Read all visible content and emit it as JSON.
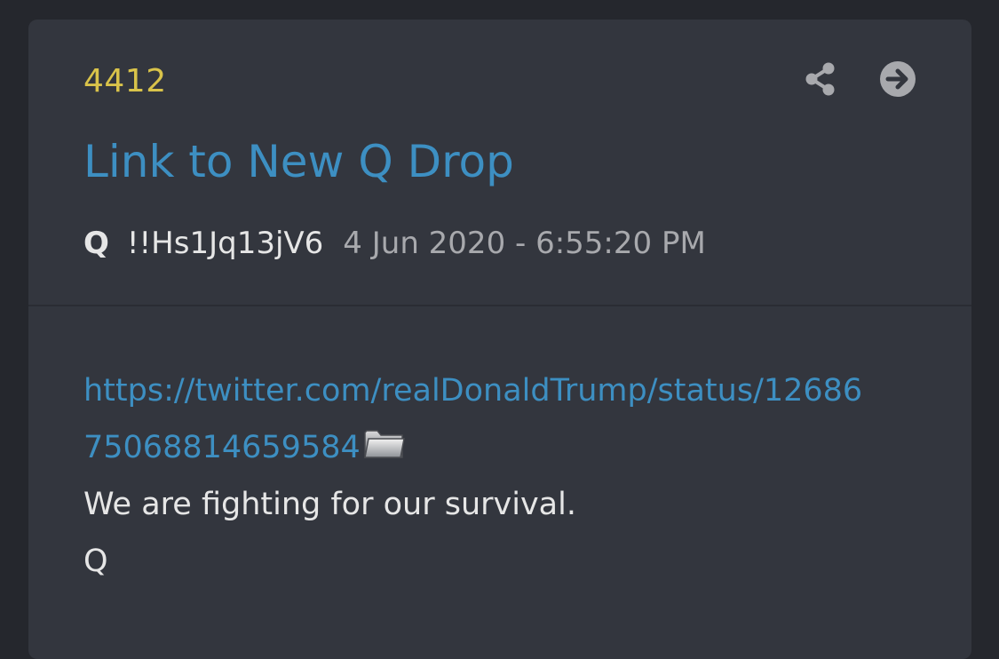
{
  "post": {
    "number": "4412",
    "title": "Link to New Q Drop",
    "author": "Q",
    "tripcode": "!!Hs1Jq13jV6",
    "timestamp": "4 Jun 2020 - 6:55:20 PM",
    "link_line1": "https://twitter.com/realDonaldTrump/status/12686",
    "link_line2": "75068814659584",
    "message": "We are fighting for our survival.",
    "signature": "Q"
  },
  "icons": {
    "share": "share-icon",
    "goto": "arrow-right-circle-icon",
    "archive": "folder-icon"
  },
  "colors": {
    "background": "#25272d",
    "card": "#33363e",
    "post_number": "#d9c34a",
    "link": "#3d8fc2",
    "text": "#e6e6e6",
    "muted": "#a8a9ad"
  }
}
